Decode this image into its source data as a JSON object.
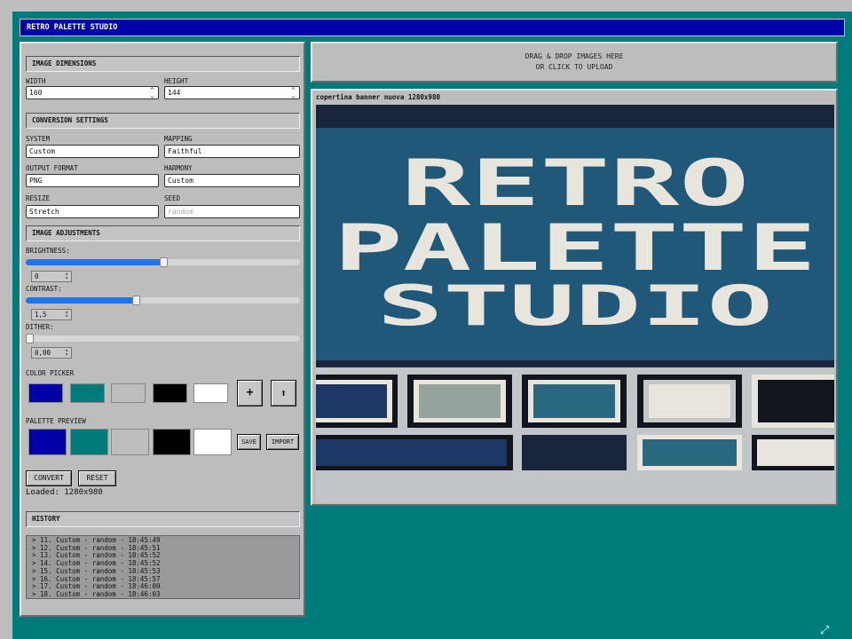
{
  "app": {
    "title": "RETRO PALETTE STUDIO"
  },
  "dimensions": {
    "heading": "IMAGE DIMENSIONS",
    "width_label": "WIDTH",
    "width_value": "160",
    "height_label": "HEIGHT",
    "height_value": "144"
  },
  "conversion": {
    "heading": "CONVERSION SETTINGS",
    "system_label": "SYSTEM",
    "system_value": "Custom",
    "mapping_label": "MAPPING",
    "mapping_value": "Faithful",
    "output_label": "OUTPUT FORMAT",
    "output_value": "PNG",
    "harmony_label": "HARMONY",
    "harmony_value": "Custom",
    "resize_label": "RESIZE",
    "resize_value": "Stretch",
    "seed_label": "SEED",
    "seed_placeholder": "random"
  },
  "adjustments": {
    "heading": "IMAGE ADJUSTMENTS",
    "brightness_label": "BRIGHTNESS:",
    "brightness_value": "0",
    "brightness_fraction": 0.5,
    "contrast_label": "CONTRAST:",
    "contrast_value": "1,5",
    "contrast_fraction": 0.4,
    "dither_label": "DITHER:",
    "dither_value": "0,00",
    "dither_fraction": 0.0
  },
  "color_picker": {
    "label": "COLOR PICKER",
    "colors": [
      "#0000a8",
      "#007b7b",
      "#bdbdbd",
      "#000000",
      "#ffffff"
    ],
    "add_symbol": "+",
    "upload_symbol": "⬆"
  },
  "palette_preview": {
    "label": "PALETTE PREVIEW",
    "colors": [
      "#0000a8",
      "#007b7b",
      "#bdbdbd",
      "#000000",
      "#ffffff"
    ],
    "save_label": "SAVE",
    "import_label": "IMPORT"
  },
  "actions": {
    "convert_label": "CONVERT",
    "reset_label": "RESET",
    "status": "Loaded: 1280x980"
  },
  "history": {
    "heading": "HISTORY",
    "items": [
      "> 11. Custom - random - 18:45:49",
      "> 12. Custom - random - 18:45:51",
      "> 13. Custom - random - 18:45:52",
      "> 14. Custom - random - 18:45:52",
      "> 15. Custom - random - 18:45:53",
      "> 16. Custom - random - 18:45:57",
      "> 17. Custom - random - 18:46:00",
      "> 18. Custom - random - 18:46:03"
    ]
  },
  "dropzone": {
    "line1": "DRAG & DROP IMAGES HERE",
    "line2": "OR CLICK TO UPLOAD"
  },
  "preview": {
    "filename": "copertina banner nuova 1280x980",
    "image_text": [
      "RETRO",
      "PALETTE",
      "STUDIO"
    ],
    "colors": {
      "dark": "#18253a",
      "teal": "#1f5878",
      "light": "#e8e6dc",
      "panel": "#c2c6c8",
      "navy": "#1d3767",
      "sage": "#94a39c",
      "cyan": "#2a6880",
      "black": "#12161c"
    }
  },
  "icons": {
    "expand": "expand-icon"
  }
}
